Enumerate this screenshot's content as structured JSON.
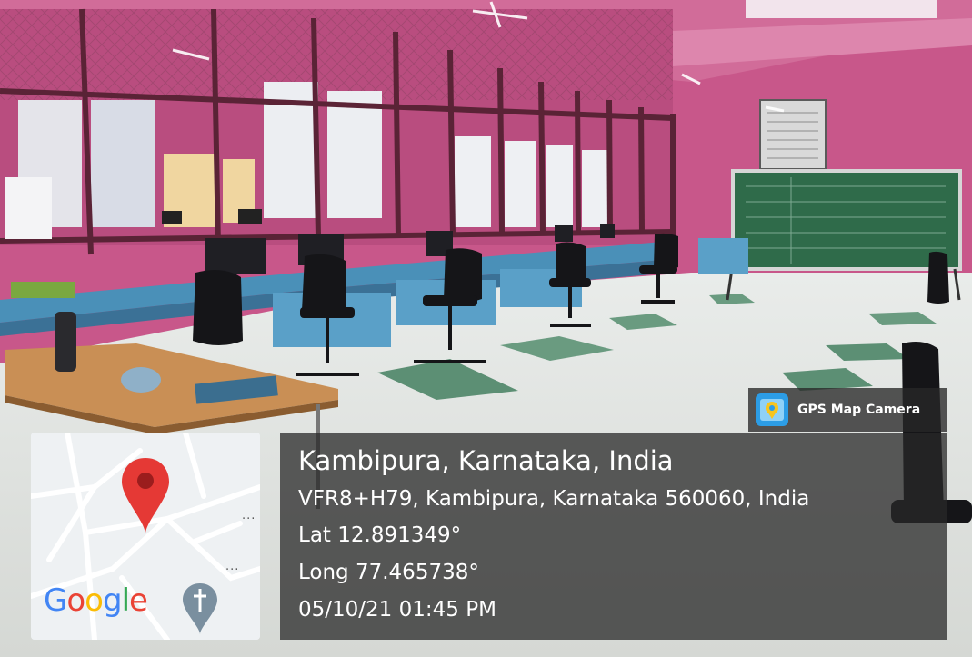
{
  "overlay": {
    "brand": {
      "label": "GPS Map Camera",
      "icon": "map-pin-app-icon"
    },
    "location": {
      "place": "Kambipura, Karnataka, India",
      "address": "VFR8+H79, Kambipura, Karnataka 560060, India",
      "lat": "Lat 12.891349°",
      "long": "Long 77.465738°",
      "datetime": "05/10/21 01:45 PM"
    },
    "map": {
      "logo_letters": [
        "G",
        "o",
        "o",
        "g",
        "l",
        "e"
      ],
      "logo_colors": [
        "#4285F4",
        "#EA4335",
        "#FBBC05",
        "#4285F4",
        "#34A853",
        "#EA4335"
      ],
      "marker": "map-pin-icon",
      "poi": "church-pin-icon",
      "more_1": "...",
      "more_2": "..."
    }
  },
  "scene": {
    "subject": "computer-lab-room",
    "colors": {
      "wall": "#c8578a",
      "floor": "#e6e8e4",
      "board": "#2f6b4a",
      "desk": "#4a90b8"
    }
  }
}
